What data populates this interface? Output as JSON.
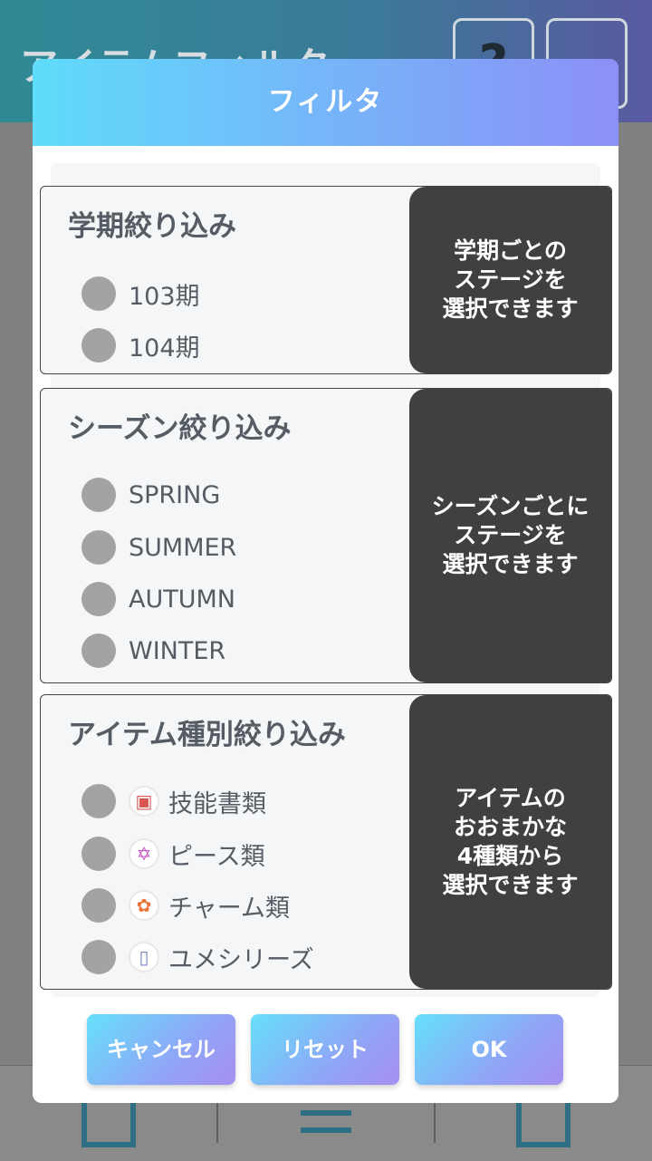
{
  "background": {
    "title": "アイテムフィルタ",
    "help_label": "?"
  },
  "dialog": {
    "title": "フィルタ",
    "sections": [
      {
        "title": "学期絞り込み",
        "options": [
          "103期",
          "104期"
        ],
        "callout": "学期ごとの\nステージを\n選択できます"
      },
      {
        "title": "シーズン絞り込み",
        "options": [
          "SPRING",
          "SUMMER",
          "AUTUMN",
          "WINTER"
        ],
        "callout": "シーズンごとに\nステージを\n選択できます"
      },
      {
        "title": "アイテム種別絞り込み",
        "options": [
          "技能書類",
          "ピース類",
          "チャーム類",
          "ユメシリーズ"
        ],
        "option_icons": [
          "book-icon",
          "piece-icon",
          "charm-icon",
          "dream-series-icon"
        ],
        "callout": "アイテムの\nおおまかな\n4種類から\n選択できます"
      }
    ],
    "buttons": {
      "cancel": "キャンセル",
      "reset": "リセット",
      "ok": "OK"
    }
  },
  "colors": {
    "header_gradient_start": "#5fdcfb",
    "header_gradient_end": "#8c8ff7",
    "callout_bg": "#404040",
    "radio": "#a3a3a3"
  }
}
